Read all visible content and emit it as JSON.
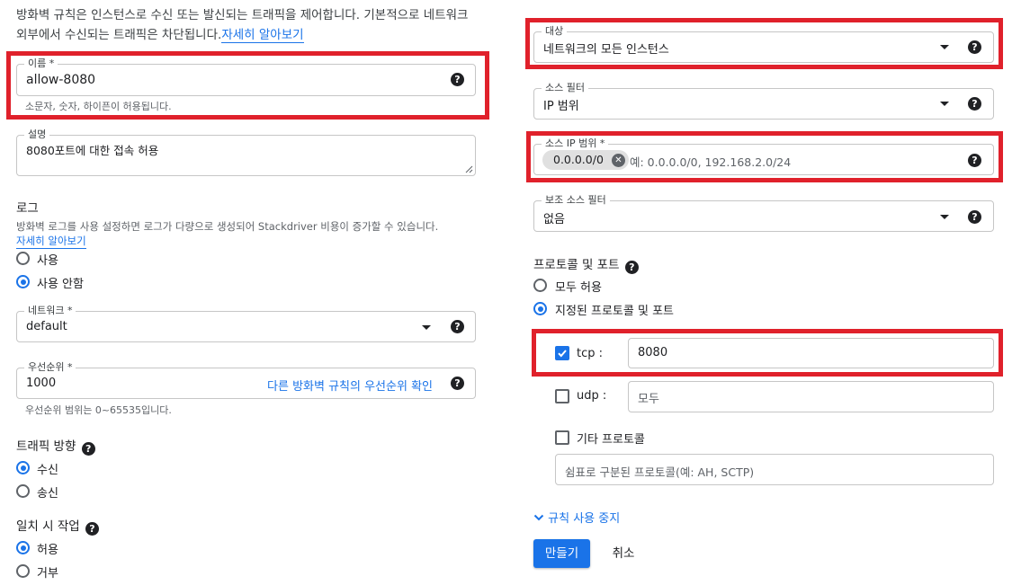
{
  "intro": {
    "text": "방화벽 규칙은 인스턴스로 수신 또는 발신되는 트래픽을 제어합니다. 기본적으로 네트워크 외부에서 수신되는 트래픽은 차단됩니다.",
    "learn_more": "자세히 알아보기"
  },
  "name_field": {
    "label": "이름 *",
    "value": "allow-8080",
    "hint": "소문자, 숫자, 하이픈이 허용됩니다."
  },
  "description_field": {
    "label": "설명",
    "value": "8080포트에 대한 접속 허용"
  },
  "logs": {
    "title": "로그",
    "description": "방화벽 로그를 사용 설정하면 로그가 다량으로 생성되어 Stackdriver 비용이 증가할 수 있습니다.",
    "learn_more": "자세히 알아보기",
    "options": [
      "사용",
      "사용 안함"
    ],
    "selected": "사용 안함"
  },
  "network_field": {
    "label": "네트워크 *",
    "value": "default"
  },
  "priority_field": {
    "label": "우선순위 *",
    "value": "1000",
    "link": "다른 방화벽 규칙의 우선순위 확인",
    "hint": "우선순위 범위는 0~65535입니다."
  },
  "direction": {
    "title": "트래픽 방향",
    "options": [
      "수신",
      "송신"
    ],
    "selected": "수신"
  },
  "action": {
    "title": "일치 시 작업",
    "options": [
      "허용",
      "거부"
    ],
    "selected": "허용"
  },
  "targets_field": {
    "label": "대상",
    "value": "네트워크의 모든 인스턴스"
  },
  "source_filter_field": {
    "label": "소스 필터",
    "value": "IP 범위"
  },
  "source_ip_field": {
    "label": "소스 IP 범위 *",
    "chip": "0.0.0.0/0",
    "placeholder": "예: 0.0.0.0/0, 192.168.2.0/24"
  },
  "second_source_filter_field": {
    "label": "보조 소스 필터",
    "value": "없음"
  },
  "protocols": {
    "title": "프로토콜 및 포트",
    "options": [
      "모두 허용",
      "지정된 프로토콜 및 포트"
    ],
    "selected": "지정된 프로토콜 및 포트",
    "tcp": {
      "label": "tcp :",
      "checked": true,
      "value": "8080"
    },
    "udp": {
      "label": "udp :",
      "checked": false,
      "placeholder": "모두"
    },
    "other": {
      "label": "기타 프로토콜",
      "checked": false,
      "placeholder": "쉼표로 구분된 프로토콜(예: AH, SCTP)"
    }
  },
  "disable_rule_label": "규칙 사용 중지",
  "buttons": {
    "create": "만들기",
    "cancel": "취소"
  },
  "colors": {
    "accent": "#1a73e8",
    "highlight": "#e0212b",
    "text": "#202124",
    "border": "#c6c6c6"
  }
}
